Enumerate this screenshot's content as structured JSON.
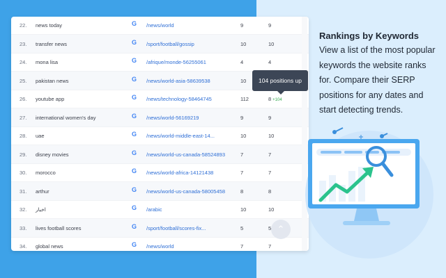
{
  "table": {
    "rows": [
      {
        "num": "22.",
        "keyword": "news today",
        "url": "/news/world",
        "pos1": "9",
        "pos2": "9",
        "delta": ""
      },
      {
        "num": "23.",
        "keyword": "transfer news",
        "url": "/sport/football/gossip",
        "pos1": "10",
        "pos2": "10",
        "delta": ""
      },
      {
        "num": "24.",
        "keyword": "mona lisa",
        "url": "/afrique/monde-56255061",
        "pos1": "4",
        "pos2": "4",
        "delta": ""
      },
      {
        "num": "25.",
        "keyword": "pakistan news",
        "url": "/news/world-asia-58639538",
        "pos1": "10",
        "pos2": "",
        "delta": ""
      },
      {
        "num": "26.",
        "keyword": "youtube app",
        "url": "/news/technology-58464745",
        "pos1": "112",
        "pos2": "8",
        "delta": "+104"
      },
      {
        "num": "27.",
        "keyword": "international women's day",
        "url": "/news/world-56169219",
        "pos1": "9",
        "pos2": "9",
        "delta": ""
      },
      {
        "num": "28.",
        "keyword": "uae",
        "url": "/news/world-middle-east-14...",
        "pos1": "10",
        "pos2": "10",
        "delta": ""
      },
      {
        "num": "29.",
        "keyword": "disney movies",
        "url": "/news/world-us-canada-58524893",
        "pos1": "7",
        "pos2": "7",
        "delta": ""
      },
      {
        "num": "30.",
        "keyword": "morocco",
        "url": "/news/world-africa-14121438",
        "pos1": "7",
        "pos2": "7",
        "delta": ""
      },
      {
        "num": "31.",
        "keyword": "arthur",
        "url": "/news/world-us-canada-58005458",
        "pos1": "8",
        "pos2": "8",
        "delta": ""
      },
      {
        "num": "32.",
        "keyword": "اخبار",
        "url": "/arabic",
        "pos1": "10",
        "pos2": "10",
        "delta": ""
      },
      {
        "num": "33.",
        "keyword": "lives football scores",
        "url": "/sport/football/scores-fix...",
        "pos1": "5",
        "pos2": "5",
        "delta": ""
      },
      {
        "num": "34.",
        "keyword": "global news",
        "url": "/news/world",
        "pos1": "7",
        "pos2": "7",
        "delta": ""
      }
    ],
    "engine_icon": "G",
    "tooltip": "104 positions up",
    "scroll_top_icon": "chevron-up-icon"
  },
  "info": {
    "title": "Rankings by Keywords",
    "description": "View a list of the most popular keywords the website ranks for. Compare their SERP positions for any dates and start detecting trends."
  },
  "colors": {
    "left_bg": "#3ea2e8",
    "right_bg": "#dbeefd",
    "link": "#2f6fd6",
    "positive": "#2ea84b",
    "tooltip_bg": "#3c4656"
  }
}
